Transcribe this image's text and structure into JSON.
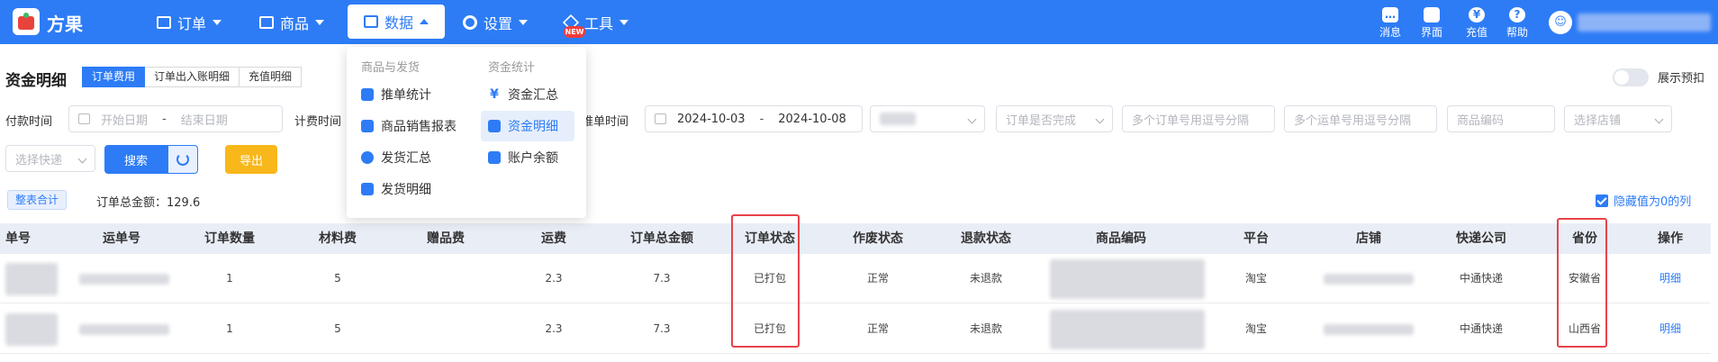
{
  "brand": {
    "name": "方果"
  },
  "nav": [
    {
      "label": "订单",
      "icon": "clipboard-icon"
    },
    {
      "label": "商品",
      "icon": "shirt-icon"
    },
    {
      "label": "数据",
      "icon": "chart-icon"
    },
    {
      "label": "设置",
      "icon": "gear-icon"
    },
    {
      "label": "工具",
      "icon": "box-icon",
      "badge": "NEW"
    }
  ],
  "toolbar_right": [
    {
      "label": "消息",
      "icon": "message-icon"
    },
    {
      "label": "界面",
      "icon": "shirt-icon"
    },
    {
      "label": "充值",
      "icon": "yen-icon"
    },
    {
      "label": "帮助",
      "icon": "help-icon"
    }
  ],
  "data_menu": {
    "group1_title": "商品与发货",
    "group2_title": "资金统计",
    "group1": [
      "推单统计",
      "商品销售报表",
      "发货汇总",
      "发货明细"
    ],
    "group2": [
      "资金汇总",
      "资金明细",
      "账户余额"
    ]
  },
  "page": {
    "title": "资金明细",
    "tabs": [
      "订单费用",
      "订单出入账明细",
      "充值明细"
    ],
    "toggle_label": "展示预扣"
  },
  "filters": {
    "pay_time_label": "付款时间",
    "start_placeholder": "开始日期",
    "end_placeholder": "结束日期",
    "fee_time_label": "计费时间",
    "push_time_label": "推单时间",
    "push_start": "2024-10-03",
    "push_end": "2024-10-08",
    "complete_placeholder": "订单是否完成",
    "order_no_placeholder": "多个订单号用逗号分隔",
    "waybill_placeholder": "多个运单号用逗号分隔",
    "product_code_placeholder": "商品编码",
    "shop_placeholder": "选择店铺",
    "express_placeholder": "选择快递",
    "range_sep": "-"
  },
  "actions": {
    "search": "搜索",
    "export": "导出"
  },
  "summary": {
    "tag": "整表合计",
    "total": "订单总金额：129.6",
    "hide_zero": "隐藏值为0的列"
  },
  "table": {
    "headers": [
      "单号",
      "运单号",
      "订单数量",
      "材料费",
      "赠品费",
      "运费",
      "订单总金额",
      "订单状态",
      "作废状态",
      "退款状态",
      "商品编码",
      "平台",
      "店铺",
      "快递公司",
      "省份",
      "操作"
    ],
    "rows": [
      {
        "qty": "1",
        "material": "5",
        "gift": "",
        "freight": "2.3",
        "total": "7.3",
        "status": "已打包",
        "void": "正常",
        "refund": "未退款",
        "platform": "淘宝",
        "express": "中通快递",
        "province": "安徽省",
        "action": "明细"
      },
      {
        "qty": "1",
        "material": "5",
        "gift": "",
        "freight": "2.3",
        "total": "7.3",
        "status": "已打包",
        "void": "正常",
        "refund": "未退款",
        "platform": "淘宝",
        "express": "中通快递",
        "province": "山西省",
        "action": "明细"
      }
    ]
  },
  "colors": {
    "primary": "#2d7cf6",
    "export": "#f8b71a",
    "highlight": "#e8434b"
  }
}
